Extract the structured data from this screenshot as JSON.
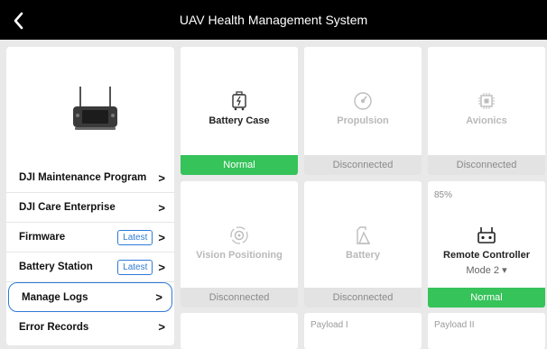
{
  "header": {
    "title": "UAV Health Management System",
    "back_icon": "chevron-left-icon"
  },
  "sidebar": {
    "device_icon": "remote-controller-icon",
    "items": [
      {
        "label": "DJI Maintenance Program",
        "tag": ""
      },
      {
        "label": "DJI Care Enterprise",
        "tag": ""
      },
      {
        "label": "Firmware",
        "tag": "Latest"
      },
      {
        "label": "Battery Station",
        "tag": "Latest"
      },
      {
        "label": "Manage Logs",
        "tag": "",
        "selected": true
      },
      {
        "label": "Error Records",
        "tag": ""
      }
    ]
  },
  "cards": {
    "battery_case": {
      "name": "Battery Case",
      "status": "Normal",
      "icon": "battery-case-icon"
    },
    "propulsion": {
      "name": "Propulsion",
      "status": "Disconnected",
      "icon": "propulsion-icon"
    },
    "avionics": {
      "name": "Avionics",
      "status": "Disconnected",
      "icon": "chip-icon"
    },
    "vision_positioning": {
      "name": "Vision Positioning",
      "status": "Disconnected",
      "icon": "vision-sensor-icon"
    },
    "battery": {
      "name": "Battery",
      "status": "Disconnected",
      "icon": "battery-icon"
    },
    "remote_controller": {
      "name": "Remote Controller",
      "status": "Normal",
      "percent": "85%",
      "mode": "Mode 2 ▾",
      "icon": "remote-controller-icon"
    },
    "payload_1": {
      "name": "Payload I"
    },
    "payload_2": {
      "name": "Payload II"
    }
  },
  "colors": {
    "normal": "#36c35a",
    "selected_border": "#2f7bd8",
    "disconnected_bg": "#e3e3e3"
  }
}
